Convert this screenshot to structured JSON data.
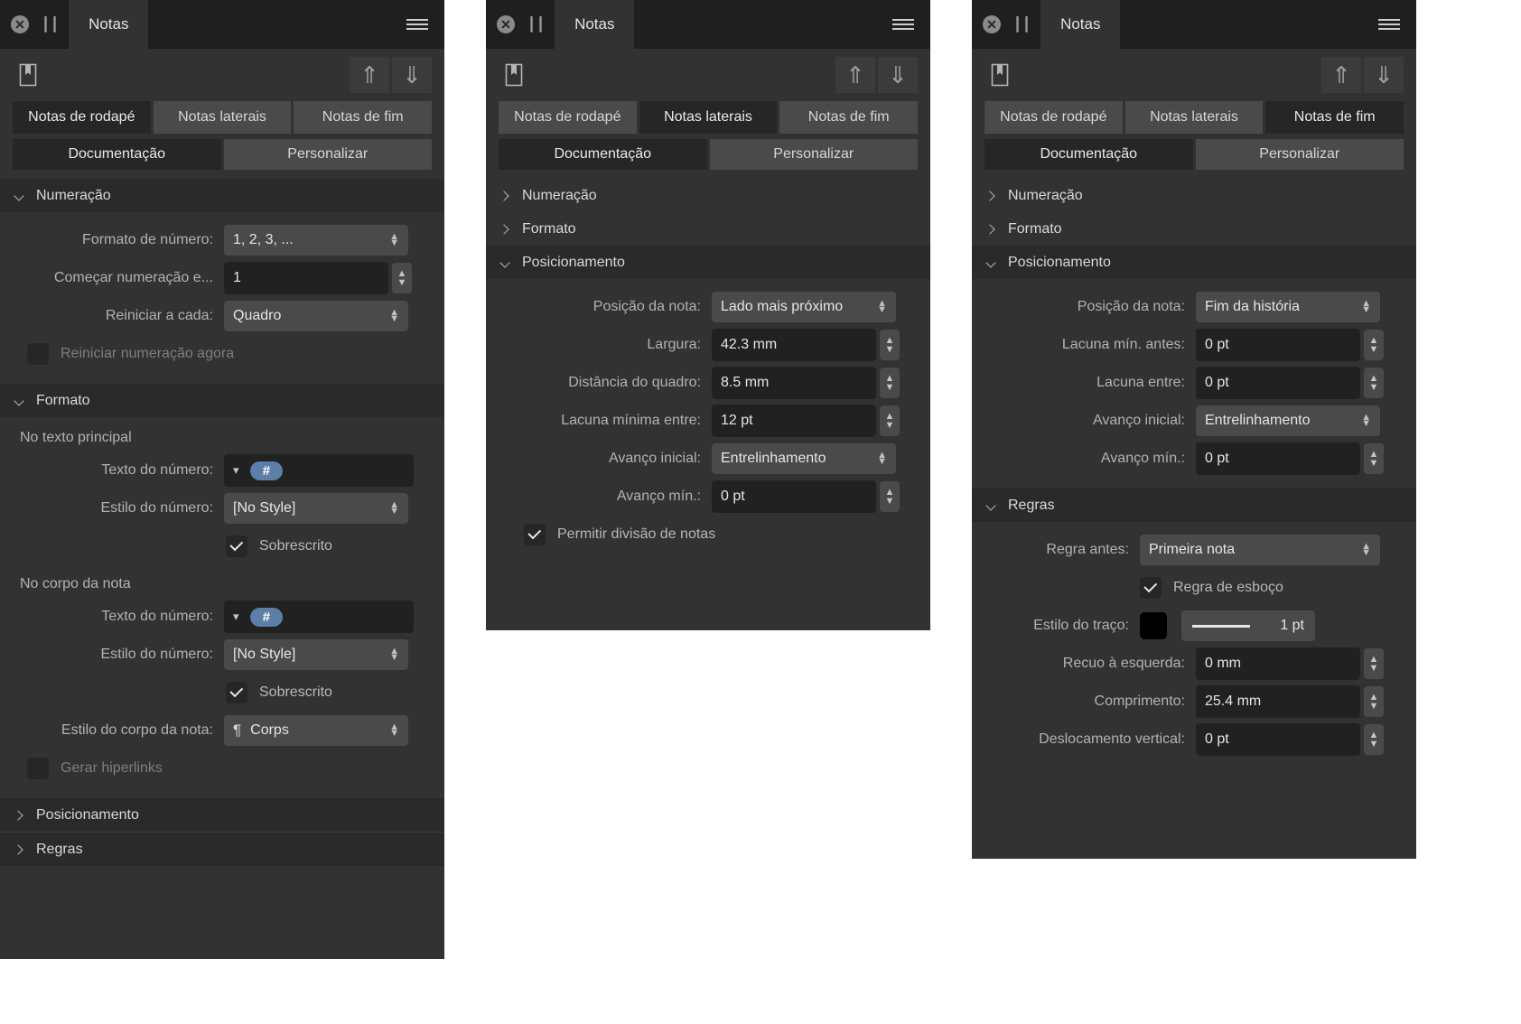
{
  "window": {
    "title": "Notas",
    "close_icon": "close-circle-icon",
    "pause_icon": "pause-icon",
    "menu_icon": "hamburger-menu-icon"
  },
  "toolbar": {
    "bookmark_icon": "bookmark-icon",
    "up_icon": "arrow-up-icon",
    "down_icon": "arrow-down-icon",
    "up_glyph": "⇑",
    "down_glyph": "⇓"
  },
  "note_tabs": [
    {
      "label": "Notas de rodapé"
    },
    {
      "label": "Notas laterais"
    },
    {
      "label": "Notas de fim"
    }
  ],
  "mode_tabs": [
    {
      "label": "Documentação"
    },
    {
      "label": "Personalizar"
    }
  ],
  "sections": {
    "numbering": "Numeração",
    "format": "Formato",
    "positioning": "Posicionamento",
    "rules": "Regras"
  },
  "panel1": {
    "active_note_tab": 0,
    "active_mode_tab": 0,
    "numbering": {
      "number_format_label": "Formato de número:",
      "number_format_value": "1, 2, 3, ...",
      "start_at_label": "Começar numeração e...",
      "start_at_value": "1",
      "restart_every_label": "Reiniciar a cada:",
      "restart_every_value": "Quadro",
      "restart_now_label": "Reiniciar numeração agora",
      "restart_now_checked": false
    },
    "format": {
      "main_text_group": "No texto principal",
      "number_text_label": "Texto do número:",
      "number_token": "#",
      "number_style_label": "Estilo do número:",
      "number_style_value": "[No Style]",
      "superscript_label": "Sobrescrito",
      "superscript_checked": true,
      "note_body_group": "No corpo da nota",
      "body_number_text_label": "Texto do número:",
      "body_number_token": "#",
      "body_number_style_label": "Estilo do número:",
      "body_number_style_value": "[No Style]",
      "body_superscript_label": "Sobrescrito",
      "body_superscript_checked": true,
      "note_body_style_label": "Estilo do corpo da nota:",
      "note_body_style_value": "Corps",
      "note_body_style_glyph": "¶",
      "hyperlinks_label": "Gerar hiperlinks",
      "hyperlinks_checked": false
    }
  },
  "panel2": {
    "active_note_tab": 1,
    "active_mode_tab": 0,
    "positioning": {
      "note_position_label": "Posição da nota:",
      "note_position_value": "Lado mais próximo",
      "width_label": "Largura:",
      "width_value": "42.3 mm",
      "frame_distance_label": "Distância do quadro:",
      "frame_distance_value": "8.5 mm",
      "min_gap_label": "Lacuna mínima entre:",
      "min_gap_value": "12 pt",
      "initial_advance_label": "Avanço inicial:",
      "initial_advance_value": "Entrelinhamento",
      "min_advance_label": "Avanço mín.:",
      "min_advance_value": "0 pt",
      "allow_split_label": "Permitir divisão de notas",
      "allow_split_checked": true
    }
  },
  "panel3": {
    "active_note_tab": 2,
    "active_mode_tab": 0,
    "positioning": {
      "note_position_label": "Posição da nota:",
      "note_position_value": "Fim da história",
      "gap_before_label": "Lacuna mín. antes:",
      "gap_before_value": "0 pt",
      "gap_between_label": "Lacuna entre:",
      "gap_between_value": "0 pt",
      "initial_advance_label": "Avanço inicial:",
      "initial_advance_value": "Entrelinhamento",
      "min_advance_label": "Avanço mín.:",
      "min_advance_value": "0 pt"
    },
    "rules": {
      "rule_before_label": "Regra antes:",
      "rule_before_value": "Primeira nota",
      "outline_rule_label": "Regra de esboço",
      "outline_rule_checked": true,
      "stroke_style_label": "Estilo do traço:",
      "stroke_color": "#000000",
      "stroke_width_value": "1 pt",
      "left_indent_label": "Recuo à esquerda:",
      "left_indent_value": "0 mm",
      "length_label": "Comprimento:",
      "length_value": "25.4 mm",
      "vertical_offset_label": "Deslocamento vertical:",
      "vertical_offset_value": "0 pt"
    }
  },
  "colors": {
    "panel_bg": "#323232",
    "titlebar_bg": "#1f1f1f",
    "section_header_bg": "#2a2a2a",
    "field_bg": "#212121",
    "combo_bg": "#4a4a4a",
    "token_blue": "#5b7fa6",
    "text": "#c9c9c9"
  }
}
